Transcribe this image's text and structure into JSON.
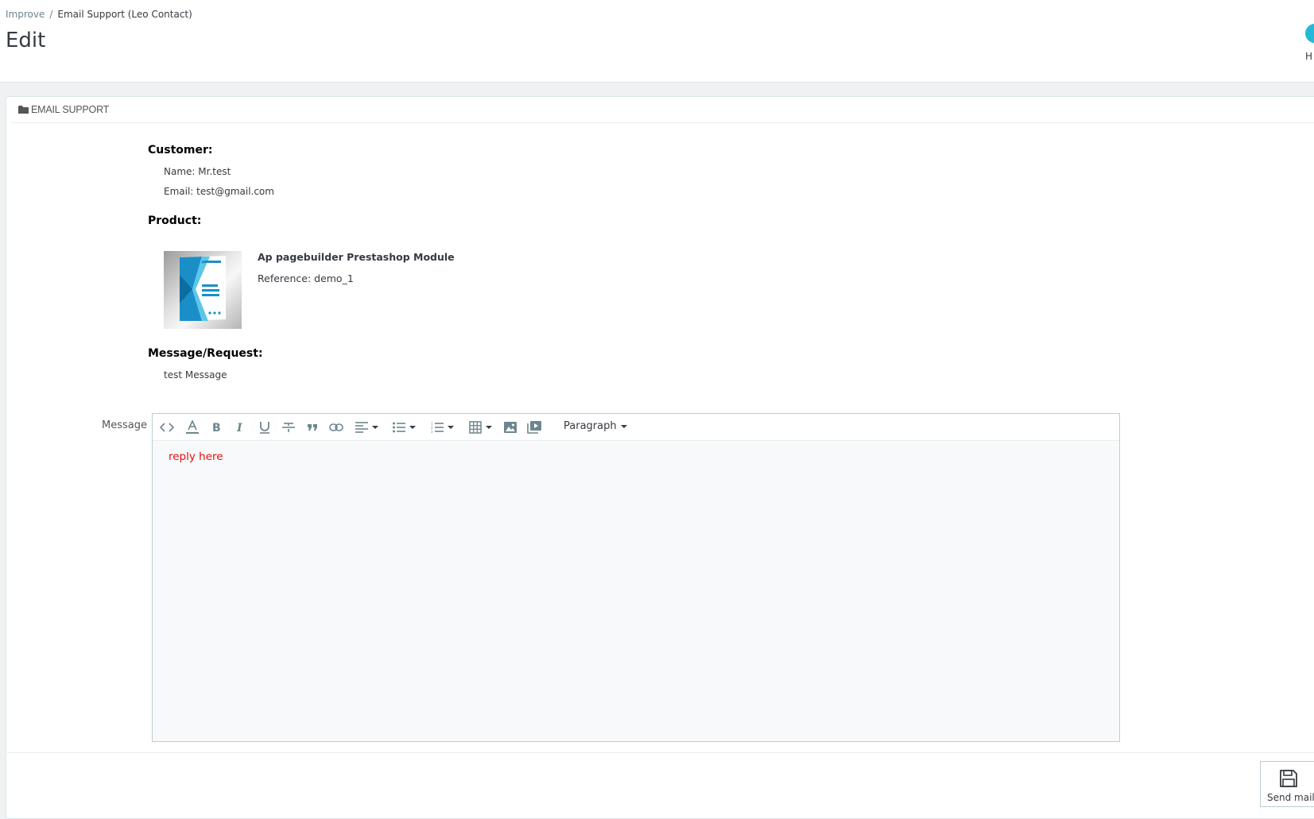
{
  "breadcrumb": {
    "parent": "Improve",
    "separator": "/",
    "current": "Email Support (Leo Contact)"
  },
  "page_title": "Edit",
  "toolbar": {
    "help_label": "H"
  },
  "panel": {
    "heading": "EMAIL SUPPORT",
    "customer": {
      "label": "Customer:",
      "name_line": "Name: Mr.test",
      "email_line": "Email: test@gmail.com"
    },
    "product": {
      "label": "Product:",
      "name": "Ap pagebuilder Prestashop Module",
      "reference_line": "Reference: demo_1"
    },
    "message_request": {
      "label": "Message/Request:",
      "text": "test Message"
    },
    "message_field": {
      "label": "Message",
      "format_selector": "Paragraph",
      "content": "reply here"
    },
    "send_button": {
      "label": "Send mail"
    }
  }
}
